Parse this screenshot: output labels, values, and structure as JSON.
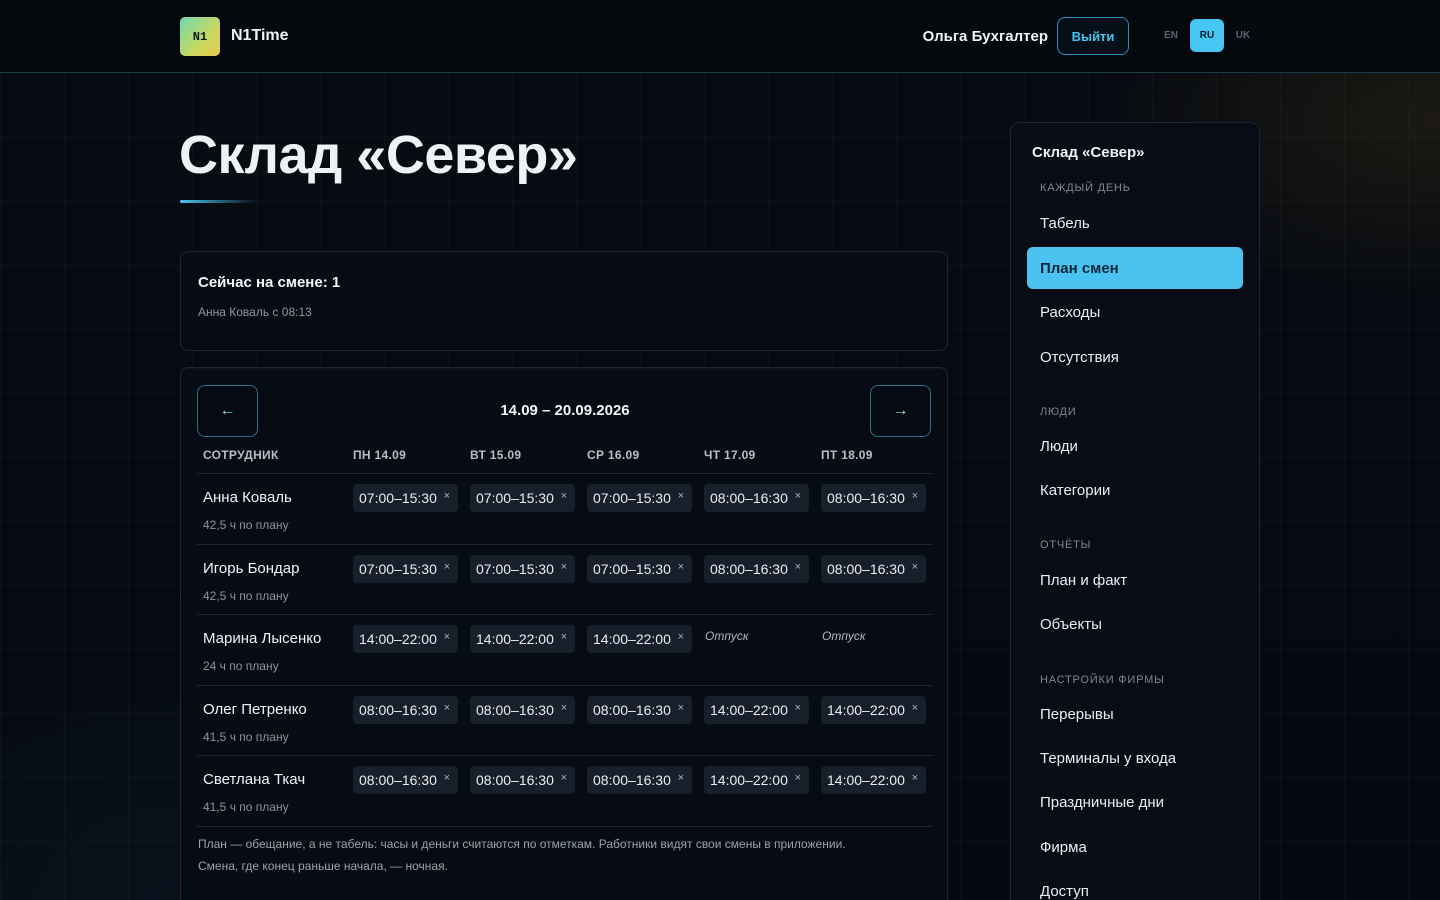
{
  "header": {
    "logo_text": "N1",
    "brand": "N1Time",
    "user_name": "Ольга Бухгалтер",
    "logout_label": "Выйти",
    "languages": [
      {
        "code": "EN",
        "active": false
      },
      {
        "code": "RU",
        "active": true
      },
      {
        "code": "UK",
        "active": false
      }
    ],
    "accent_color": "#46c6f2"
  },
  "page": {
    "title": "Склад «Север»"
  },
  "now_on_shift": {
    "title": "Сейчас на смене: 1",
    "detail": "Анна Коваль с 08:13"
  },
  "schedule": {
    "prev_label": "←",
    "next_label": "→",
    "week_range": "14.09 – 20.09.2026",
    "columns": {
      "employee": "СОТРУДНИК",
      "days": [
        "ПН 14.09",
        "ВТ 15.09",
        "СР 16.09",
        "ЧТ 17.09",
        "ПТ 18.09"
      ]
    },
    "remove_icon": "×",
    "rows": [
      {
        "name": "Анна Коваль",
        "hours": "42,5 ч по плану",
        "shifts": [
          "07:00–15:30",
          "07:00–15:30",
          "07:00–15:30",
          "08:00–16:30",
          "08:00–16:30"
        ]
      },
      {
        "name": "Игорь Бондар",
        "hours": "42,5 ч по плану",
        "shifts": [
          "07:00–15:30",
          "07:00–15:30",
          "07:00–15:30",
          "08:00–16:30",
          "08:00–16:30"
        ]
      },
      {
        "name": "Марина Лысенко",
        "hours": "24 ч по плану",
        "shifts": [
          "14:00–22:00",
          "14:00–22:00",
          "14:00–22:00",
          "Отпуск",
          "Отпуск"
        ]
      },
      {
        "name": "Олег Петренко",
        "hours": "41,5 ч по плану",
        "shifts": [
          "08:00–16:30",
          "08:00–16:30",
          "08:00–16:30",
          "14:00–22:00",
          "14:00–22:00"
        ]
      },
      {
        "name": "Светлана Ткач",
        "hours": "41,5 ч по плану",
        "shifts": [
          "08:00–16:30",
          "08:00–16:30",
          "08:00–16:30",
          "14:00–22:00",
          "14:00–22:00"
        ]
      }
    ],
    "notes": [
      "План — обещание, а не табель: часы и деньги считаются по отметкам. Работники видят свои смены в приложении.",
      "Смена, где конец раньше начала, — ночная."
    ]
  },
  "sidebar": {
    "title": "Склад «Север»",
    "sections": [
      {
        "label": "КАЖДЫЙ ДЕНЬ",
        "items": [
          {
            "label": "Табель",
            "active": false
          },
          {
            "label": "План смен",
            "active": true
          },
          {
            "label": "Расходы",
            "active": false
          },
          {
            "label": "Отсутствия",
            "active": false
          }
        ]
      },
      {
        "label": "ЛЮДИ",
        "items": [
          {
            "label": "Люди",
            "active": false
          },
          {
            "label": "Категории",
            "active": false
          }
        ]
      },
      {
        "label": "ОТЧЁТЫ",
        "items": [
          {
            "label": "План и факт",
            "active": false
          },
          {
            "label": "Объекты",
            "active": false
          }
        ]
      },
      {
        "label": "НАСТРОЙКИ ФИРМЫ",
        "items": [
          {
            "label": "Перерывы",
            "active": false
          },
          {
            "label": "Терминалы у входа",
            "active": false
          },
          {
            "label": "Праздничные дни",
            "active": false
          },
          {
            "label": "Фирма",
            "active": false
          },
          {
            "label": "Доступ",
            "active": false
          }
        ]
      }
    ]
  }
}
